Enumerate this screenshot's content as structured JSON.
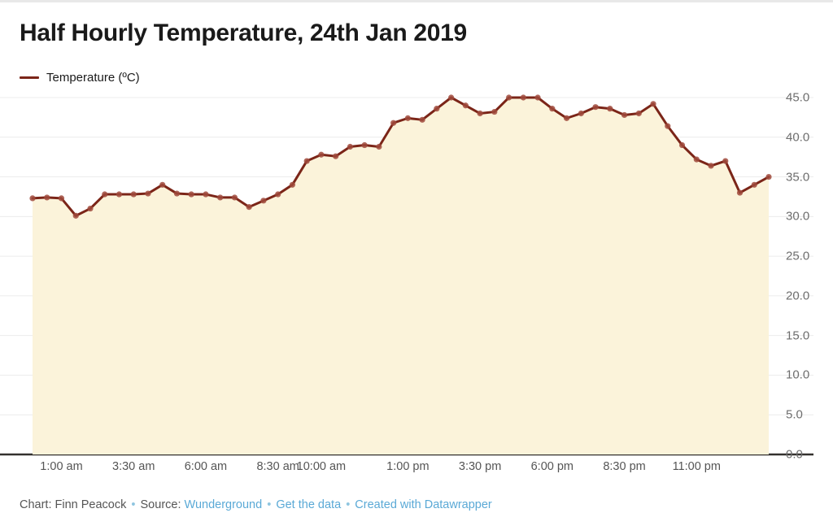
{
  "header": {
    "title": "Half Hourly Temperature, 24th Jan 2019"
  },
  "legend": {
    "label": "Temperature (ºC)",
    "color": "#7B2518"
  },
  "footer": {
    "prefix": "Chart: Finn Peacock",
    "sep1": "•",
    "source_label": "Source:",
    "source_link": "Wunderground",
    "sep2": "•",
    "data_link": "Get the data",
    "sep3": "•",
    "credit_link": "Created with Datawrapper"
  },
  "style": {
    "line_color": "#7B2518",
    "marker_color": "#A04A3C",
    "fill_color": "#FBF3DA",
    "grid_color": "#ECECEC",
    "axis_color": "#33312E",
    "link_color": "#5aa9d6",
    "text_color": "#555555"
  },
  "chart_data": {
    "type": "area",
    "title": "Half Hourly Temperature, 24th Jan 2019",
    "xlabel": "",
    "ylabel": "",
    "ylim": [
      0,
      45
    ],
    "ytick_labels": [
      "45.0",
      "40.0",
      "35.0",
      "30.0",
      "25.0",
      "20.0",
      "15.0",
      "10.0",
      "5.0",
      "0.0"
    ],
    "ytick_values": [
      45,
      40,
      35,
      30,
      25,
      20,
      15,
      10,
      5,
      0
    ],
    "xtick_labels": [
      "1:00 am",
      "3:30 am",
      "6:00 am",
      "8:30 am",
      "10:00 am",
      "1:00 pm",
      "3:30 pm",
      "6:00 pm",
      "8:30 pm",
      "11:00 pm"
    ],
    "xtick_indices": [
      2,
      7,
      12,
      17,
      20,
      26,
      31,
      36,
      41,
      46
    ],
    "grid": true,
    "legend_position": "top-left",
    "series": [
      {
        "name": "Temperature (ºC)",
        "color": "#7B2518",
        "x": [
          "0:00",
          "0:30",
          "1:00",
          "1:30",
          "2:00",
          "2:30",
          "3:00",
          "3:30",
          "4:00",
          "4:30",
          "5:00",
          "5:30",
          "6:00",
          "6:30",
          "7:00",
          "7:30",
          "8:00",
          "8:30",
          "9:00",
          "9:30",
          "10:00",
          "10:30",
          "11:00",
          "11:30",
          "12:00",
          "12:30",
          "13:00",
          "13:30",
          "14:00",
          "14:30",
          "15:00",
          "15:30",
          "16:00",
          "16:30",
          "17:00",
          "17:30",
          "18:00",
          "18:30",
          "19:00",
          "19:30",
          "20:00",
          "20:30",
          "21:00",
          "21:30",
          "22:00",
          "22:30",
          "23:00",
          "23:30"
        ],
        "values": [
          32.3,
          32.4,
          32.3,
          30.1,
          31.0,
          32.8,
          32.8,
          32.8,
          32.9,
          34.0,
          32.9,
          32.8,
          32.8,
          32.4,
          32.4,
          31.2,
          32.0,
          32.8,
          34.0,
          37.0,
          37.8,
          37.6,
          38.8,
          39.0,
          38.8,
          41.8,
          42.4,
          42.2,
          43.6,
          45.0,
          44.0,
          43.0,
          43.2,
          45.0,
          45.0,
          45.0,
          43.6,
          42.4,
          43.0,
          43.8,
          43.6,
          42.8,
          43.0,
          44.2,
          41.4,
          39.0,
          37.2,
          36.4,
          37.0,
          33.0,
          34.0,
          35.0
        ]
      }
    ]
  }
}
